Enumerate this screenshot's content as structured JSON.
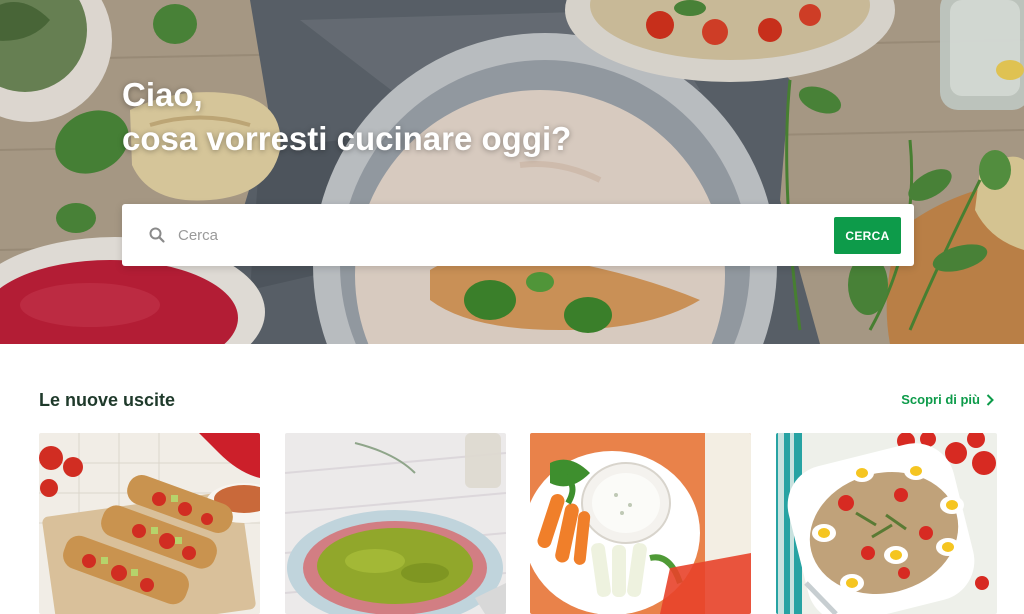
{
  "hero": {
    "greeting": "Ciao,",
    "question": "cosa vorresti cucinare oggi?"
  },
  "search": {
    "placeholder": "Cerca",
    "button_label": "CERCA",
    "icon": "search-icon"
  },
  "new_releases": {
    "title": "Le nuove uscite",
    "more_label": "Scopri di più",
    "more_icon": "chevron-right-icon",
    "cards": [
      {
        "dish": "bruschette-photo"
      },
      {
        "dish": "carpaccio-pesto-photo"
      },
      {
        "dish": "crudites-dip-photo"
      },
      {
        "dish": "salad-eggs-photo"
      }
    ]
  },
  "colors": {
    "accent_green": "#0d9b4a",
    "heading_dark_green": "#1f3a2b"
  }
}
